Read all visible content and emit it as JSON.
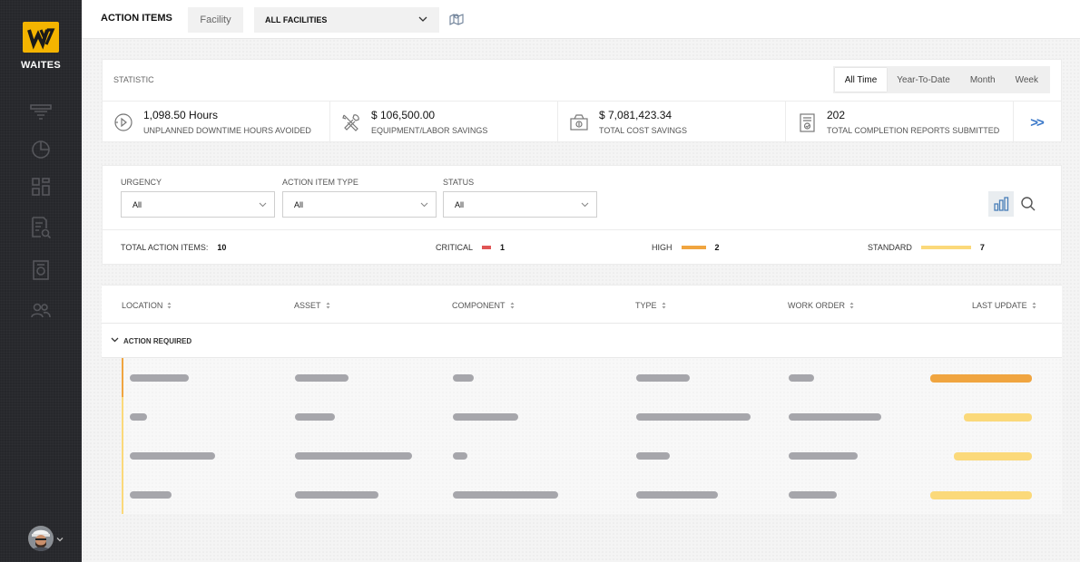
{
  "brand": {
    "name": "WAITES",
    "logo_color": "#f4b400"
  },
  "sidebar": {
    "items": [
      {
        "name": "filter-icon"
      },
      {
        "name": "pie-chart-icon"
      },
      {
        "name": "dashboard-icon"
      },
      {
        "name": "report-search-icon"
      },
      {
        "name": "document-icon"
      },
      {
        "name": "users-icon"
      }
    ]
  },
  "header": {
    "title": "ACTION ITEMS",
    "facility_label": "Facility",
    "facility_value": "ALL FACILITIES",
    "map_icon": "map-icon"
  },
  "statistic": {
    "title": "STATISTIC",
    "periods": [
      "All Time",
      "Year-To-Date",
      "Month",
      "Week"
    ],
    "active_period": "All Time",
    "cards": [
      {
        "icon": "downtime-clock-icon",
        "value": "1,098.50 Hours",
        "label": "UNPLANNED DOWNTIME HOURS AVOIDED"
      },
      {
        "icon": "tools-icon",
        "value": "$ 106,500.00",
        "label": "EQUIPMENT/LABOR SAVINGS"
      },
      {
        "icon": "wallet-icon",
        "value": "$ 7,081,423.34",
        "label": "TOTAL COST SAVINGS"
      },
      {
        "icon": "report-icon",
        "value": "202",
        "label": "TOTAL COMPLETION REPORTS SUBMITTED"
      }
    ],
    "more": ">>"
  },
  "filters": {
    "urgency": {
      "label": "URGENCY",
      "value": "All"
    },
    "type": {
      "label": "ACTION ITEM TYPE",
      "value": "All"
    },
    "status": {
      "label": "STATUS",
      "value": "All"
    }
  },
  "summary": {
    "total_label": "TOTAL ACTION ITEMS:",
    "total": "10",
    "critical_label": "CRITICAL",
    "critical": "1",
    "high_label": "HIGH",
    "high": "2",
    "standard_label": "STANDARD",
    "standard": "7"
  },
  "colors": {
    "critical": "#e05555",
    "high": "#f0a540",
    "standard": "#fbd97a",
    "accent": "#3a78c9",
    "skeleton": "#a6a6ab"
  },
  "table": {
    "columns": [
      "LOCATION",
      "ASSET",
      "COMPONENT",
      "TYPE",
      "WORK ORDER",
      "LAST UPDATE"
    ],
    "group": "ACTION REQUIRED",
    "rows": [
      {
        "urgency": "high"
      },
      {
        "urgency": "standard"
      },
      {
        "urgency": "standard"
      },
      {
        "urgency": "standard"
      }
    ]
  }
}
